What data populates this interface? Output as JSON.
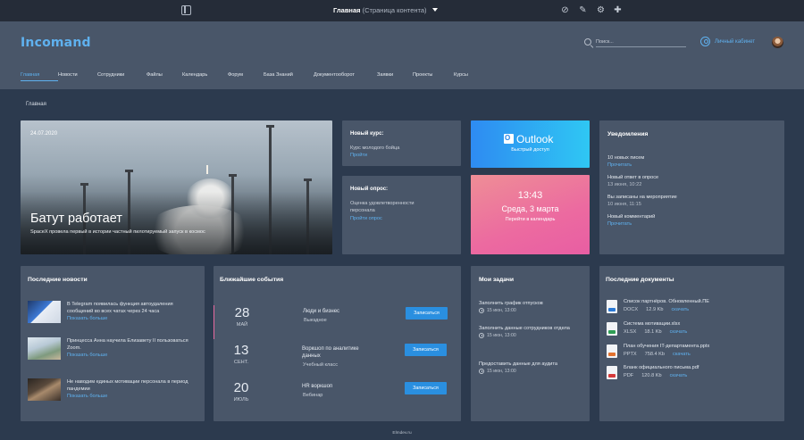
{
  "topbar": {
    "title": "Главная",
    "subtitle": "(Страница контента)"
  },
  "header": {
    "logo": "Incomand",
    "search_placeholder": "Поиск...",
    "cabinet_label": "Личный кабинет"
  },
  "nav": [
    "Главная",
    "Новости",
    "Сотрудники",
    "Файлы",
    "Календарь",
    "Форум",
    "База Знаний",
    "Документооборот",
    "Заявки",
    "Проекты",
    "Курсы"
  ],
  "breadcrumb": "Главная",
  "hero": {
    "date": "24.07.2020",
    "title": "Батут работает",
    "text": "SpaceX провела первый в истории частный пилотируемый запуск в космос"
  },
  "course": {
    "title": "Новый курс:",
    "name": "Курс молодого бойца",
    "link": "Пройти"
  },
  "poll": {
    "title": "Новый опрос:",
    "name": "Оценка удовлетворенности персонала",
    "link": "Пройти опрос"
  },
  "outlook": {
    "name": "Outlook",
    "sub": "Быстрый доступ"
  },
  "calendar": {
    "time": "13:43",
    "date": "Среда, 3 марта",
    "link": "Перейти в календарь"
  },
  "notifications": {
    "title": "Уведомления",
    "items": [
      {
        "text": "10 новых писем",
        "meta": "Прочитать",
        "meta_is_link": true
      },
      {
        "text": "Новый ответ в опросе",
        "meta": "13 июня, 10:22",
        "meta_is_link": false
      },
      {
        "text": "Вы записаны на мероприятие",
        "meta": "10 июня, 11:15",
        "meta_is_link": false
      },
      {
        "text": "Новый комментарий",
        "meta": "Прочитать",
        "meta_is_link": true
      }
    ]
  },
  "news": {
    "title": "Последние новости",
    "more": "Показать больше",
    "items": [
      {
        "text": "В Telegram появилась функция автоудаления сообщений во всех чатах через 24 часа"
      },
      {
        "text": "Принцесса Анна научила Елизавету II пользоваться Zoom."
      },
      {
        "text": "Не наводим единых мотивации персонала в период пандемии"
      }
    ]
  },
  "events": {
    "title": "Ближайшие события",
    "button": "Записаться",
    "items": [
      {
        "day": "28",
        "month": "МАЙ",
        "name": "Люди и бизнес",
        "type": "Выездное"
      },
      {
        "day": "13",
        "month": "СЕНТ.",
        "name": "Воркшоп по аналитике данных",
        "type": "Учебный класс"
      },
      {
        "day": "20",
        "month": "ИЮЛЬ",
        "name": "HR воркшоп",
        "type": "Вебинар"
      }
    ]
  },
  "tasks": {
    "title": "Мои задачи",
    "items": [
      {
        "text": "Заполнить график отпусков",
        "when": "15 июн, 13:00"
      },
      {
        "text": "Заполнить данные сотрудников отдела",
        "when": "15 июн, 13:00"
      },
      {
        "text": "Предоставить данные для аудита",
        "when": "15 июн, 13:00"
      }
    ]
  },
  "docs": {
    "title": "Последние документы",
    "download": "скачать",
    "items": [
      {
        "name": "Список партнёров. Обновленный.ПЕ",
        "type": "DOCX",
        "size": "12.9 Kb",
        "color": "#2b7ad6"
      },
      {
        "name": "Система мотивации.xlsx",
        "type": "XLSX",
        "size": "18.1 Kb",
        "color": "#2f9e55"
      },
      {
        "name": "План обучения IT-департамента.pptx",
        "type": "PPTX",
        "size": "758.4 Kb",
        "color": "#e2722f"
      },
      {
        "name": "Бланк официального письма.pdf",
        "type": "PDF",
        "size": "120.8 Kb",
        "color": "#d63a3a"
      }
    ]
  },
  "footer": "Elmdev.ru"
}
